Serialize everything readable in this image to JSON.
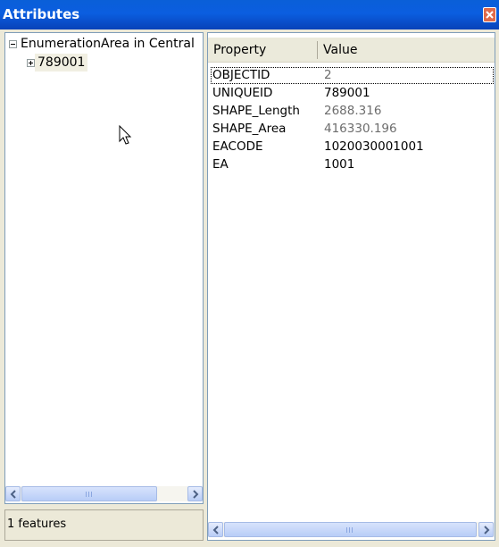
{
  "window": {
    "title": "Attributes"
  },
  "tree": {
    "root_label": "EnumerationArea in Central",
    "child_label": "789001"
  },
  "status": {
    "feature_count": "1 features"
  },
  "grid": {
    "columns": [
      "Property",
      "Value"
    ],
    "rows": [
      {
        "property": "OBJECTID",
        "value": "2",
        "color": "#6d6d6d"
      },
      {
        "property": "UNIQUEID",
        "value": "789001",
        "color": "#000000"
      },
      {
        "property": "SHAPE_Length",
        "value": "2688.316",
        "color": "#6d6d6d"
      },
      {
        "property": "SHAPE_Area",
        "value": "416330.196",
        "color": "#6d6d6d"
      },
      {
        "property": "EACODE",
        "value": "1020030001001",
        "color": "#000000"
      },
      {
        "property": "EA",
        "value": "1001",
        "color": "#000000"
      }
    ]
  },
  "icons": {
    "close": "close-icon",
    "cursor": "mouse-pointer-icon",
    "scroll_left": "chevron-left-icon",
    "scroll_right": "chevron-right-icon"
  },
  "colors": {
    "titlebar": "#0a5fd8",
    "window_bg": "#ece9d8",
    "close_btn": "#e06a4a"
  }
}
